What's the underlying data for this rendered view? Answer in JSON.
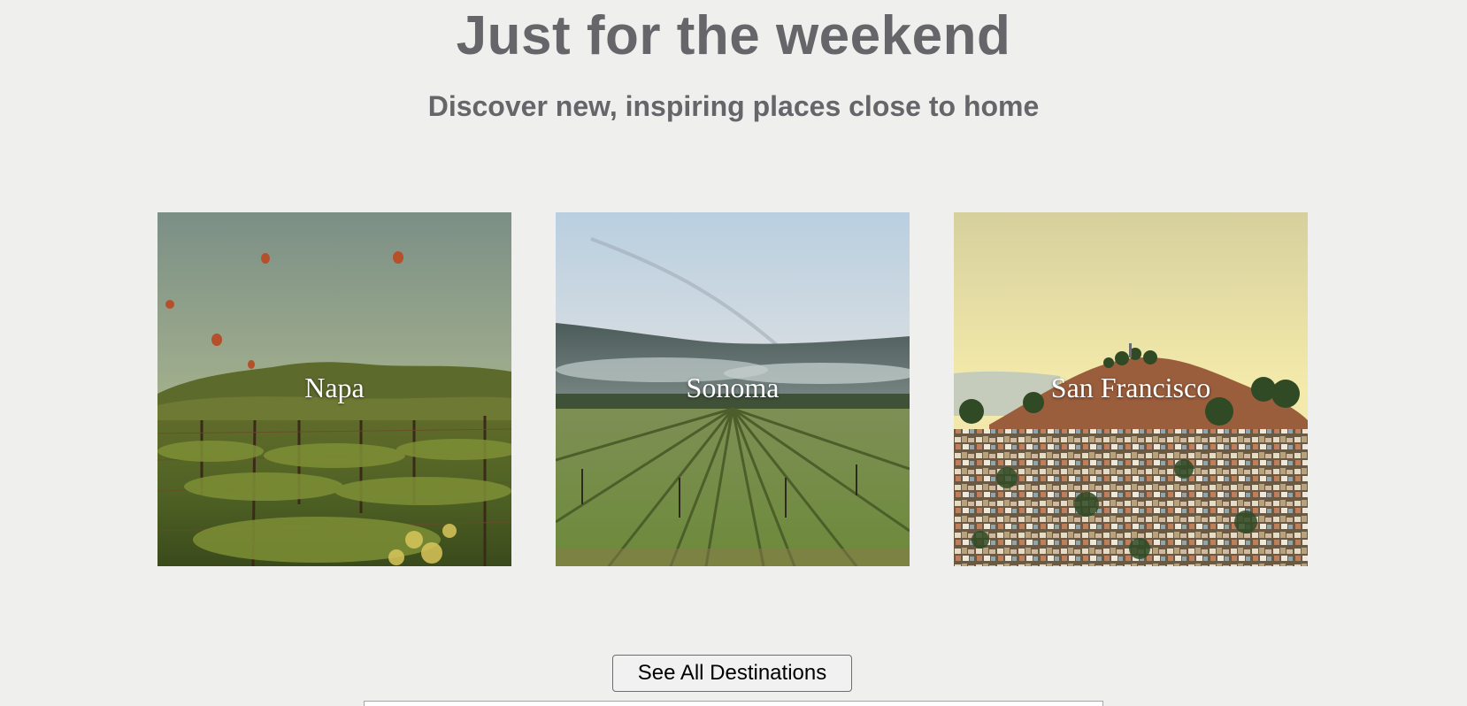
{
  "header": {
    "title": "Just for the weekend",
    "subtitle": "Discover new, inspiring places close to home"
  },
  "destinations": [
    {
      "label": "Napa",
      "image": "vineyard-with-hot-air-balloons"
    },
    {
      "label": "Sonoma",
      "image": "misty-vineyard-rows"
    },
    {
      "label": "San Francisco",
      "image": "hillside-city-houses"
    }
  ],
  "cta": {
    "label": "See All Destinations"
  },
  "colors": {
    "background": "#efefed",
    "heading": "#65656a",
    "card_label": "#ffffff"
  }
}
